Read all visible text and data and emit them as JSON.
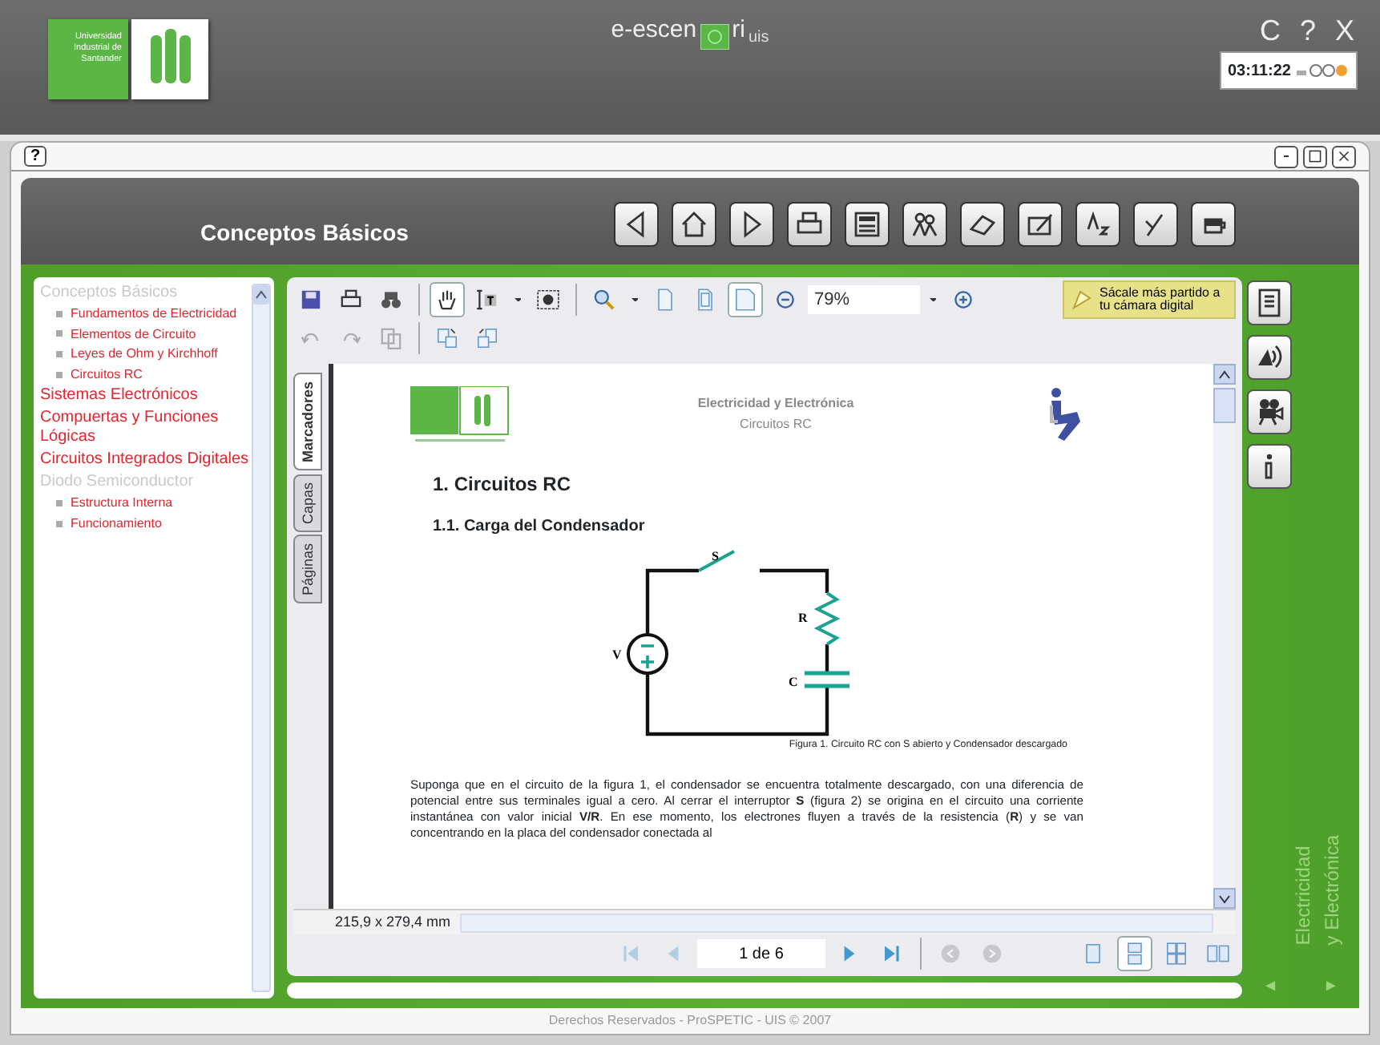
{
  "app": {
    "logo_text": "Universidad Industrial de Santander",
    "title": "e-escen",
    "title_suffix": "ri",
    "title_sub": "uis",
    "window_controls": [
      "C",
      "?",
      "X"
    ],
    "clock": "03:11:22"
  },
  "frame": {
    "help": "?",
    "controls": [
      {
        "kind": "minimize"
      },
      {
        "kind": "maximize"
      },
      {
        "kind": "close"
      }
    ]
  },
  "header": {
    "title": "Conceptos Básicos",
    "tools": [
      {
        "kind": "back"
      },
      {
        "kind": "home"
      },
      {
        "kind": "forward"
      },
      {
        "kind": "print"
      },
      {
        "kind": "calculator"
      },
      {
        "kind": "people"
      },
      {
        "kind": "eraser"
      },
      {
        "kind": "notes"
      },
      {
        "kind": "glossary"
      },
      {
        "kind": "pen"
      },
      {
        "kind": "cup"
      }
    ]
  },
  "sidebar": {
    "items": [
      {
        "label": "Conceptos Básicos",
        "expanded": true,
        "children": [
          {
            "label": "Fundamentos de Electricidad"
          },
          {
            "label": "Elementos de Circuito"
          },
          {
            "label": "Leyes de Ohm y Kirchhoff"
          },
          {
            "label": "Circuitos RC"
          }
        ]
      },
      {
        "label": "Sistemas Electrónicos",
        "expanded": false
      },
      {
        "label": "Compuertas y Funciones Lógicas",
        "expanded": false
      },
      {
        "label": "Circuitos Integrados Digitales",
        "expanded": false
      },
      {
        "label": "Diodo Semiconductor",
        "expanded": true,
        "children": [
          {
            "label": "Estructura Interna"
          },
          {
            "label": "Funcionamiento"
          }
        ]
      }
    ]
  },
  "viewer": {
    "toolbar": [
      {
        "kind": "save",
        "pressed": false,
        "disabled": false
      },
      {
        "kind": "print",
        "pressed": false,
        "disabled": false
      },
      {
        "kind": "find",
        "pressed": false,
        "disabled": false
      },
      {
        "kind": "separator"
      },
      {
        "kind": "hand",
        "pressed": true,
        "disabled": false
      },
      {
        "kind": "text-select",
        "pressed": false,
        "disabled": false
      },
      {
        "kind": "caret",
        "pressed": false,
        "disabled": false
      },
      {
        "kind": "snapshot",
        "pressed": false,
        "disabled": false
      },
      {
        "kind": "separator"
      },
      {
        "kind": "magnifier",
        "pressed": false,
        "disabled": false
      },
      {
        "kind": "caret",
        "pressed": false,
        "disabled": false
      },
      {
        "kind": "actual-size",
        "pressed": false,
        "disabled": false
      },
      {
        "kind": "fit-page",
        "pressed": false,
        "disabled": false
      },
      {
        "kind": "fit-width",
        "pressed": true,
        "disabled": false
      },
      {
        "kind": "zoom-out",
        "pressed": false,
        "disabled": false
      },
      {
        "kind": "zoom-field",
        "value": "79%"
      },
      {
        "kind": "caret",
        "pressed": false,
        "disabled": false
      },
      {
        "kind": "zoom-in",
        "pressed": false,
        "disabled": false
      }
    ],
    "toolbar_2": [
      {
        "kind": "undo",
        "pressed": false,
        "disabled": true
      },
      {
        "kind": "redo",
        "pressed": false,
        "disabled": true
      },
      {
        "kind": "copy",
        "pressed": false,
        "disabled": true
      },
      {
        "kind": "separator"
      },
      {
        "kind": "rotate-right",
        "pressed": false,
        "disabled": false
      },
      {
        "kind": "rotate-left",
        "pressed": false,
        "disabled": false
      }
    ],
    "tip": "Sácale más partido a tu cámara digital",
    "side_tabs": [
      {
        "label": "Marcadores",
        "selected": true
      },
      {
        "label": "Capas",
        "selected": false
      },
      {
        "label": "Páginas",
        "selected": false
      }
    ],
    "document": {
      "header_title": "Electricidad y Electrónica",
      "header_subtitle": "Circuitos RC",
      "heading": "1.   Circuitos RC",
      "subheading": "1.1.   Carga del Condensador",
      "circuit_labels": [
        "S",
        "R",
        "V",
        "C"
      ],
      "caption": "Figura 1. Circuito RC con S abierto y Condensador descargado",
      "paragraph": "Suponga que en el circuito de la figura 1, el condensador se encuentra totalmente descargado, con una diferencia de potencial entre sus terminales igual a cero.  Al cerrar el interruptor **S** (figura 2) se origina en el circuito una corriente instantánea con valor inicial **V/R**.  En ese momento, los electrones fluyen a través de la resistencia (**R**) y se van concentrando en la placa del condensador conectada al"
    },
    "page_size": "215,9 x 279,4 mm",
    "nav": [
      {
        "kind": "first",
        "disabled": true
      },
      {
        "kind": "previous",
        "disabled": true
      },
      {
        "kind": "page-field",
        "value": "1 de 6"
      },
      {
        "kind": "next",
        "disabled": false
      },
      {
        "kind": "last",
        "disabled": false
      },
      {
        "kind": "separator"
      },
      {
        "kind": "go-back",
        "disabled": true
      },
      {
        "kind": "go-forward",
        "disabled": true
      }
    ],
    "views": [
      {
        "kind": "single",
        "selected": false
      },
      {
        "kind": "continuous",
        "selected": true
      },
      {
        "kind": "facing-continuous",
        "selected": false
      },
      {
        "kind": "facing",
        "selected": false
      }
    ]
  },
  "side_buttons": [
    {
      "kind": "document"
    },
    {
      "kind": "audio"
    },
    {
      "kind": "video"
    },
    {
      "kind": "info"
    }
  ],
  "brand": [
    "Electricidad",
    "y Electrónica"
  ],
  "brand_arrows": [
    "◄",
    "►"
  ],
  "footer": "Derechos Reservados - ProSPETIC - UIS © 2007"
}
